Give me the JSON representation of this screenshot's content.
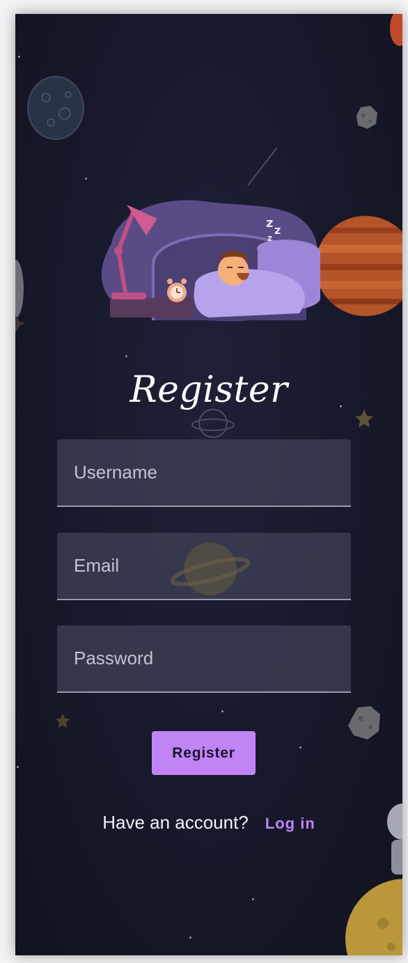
{
  "title": "Register",
  "form": {
    "username_placeholder": "Username",
    "email_placeholder": "Email",
    "password_placeholder": "Password",
    "submit_label": "Register"
  },
  "footer": {
    "prompt": "Have an account?",
    "login_label": "Log in"
  },
  "illustration": {
    "snore_text": "Z Z z"
  },
  "colors": {
    "accent": "#c084f5",
    "background": "#181a2c",
    "field_bg": "#3e4054",
    "text": "#ffffff"
  },
  "icons": [
    "sleeping-person-illustration",
    "desk-lamp-icon",
    "alarm-clock-icon",
    "planet-icon",
    "moon-icon",
    "star-icon",
    "asteroid-icon"
  ]
}
